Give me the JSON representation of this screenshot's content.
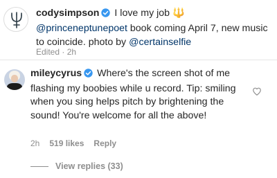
{
  "post": {
    "username": "codysimpson",
    "caption_start": "I love my job",
    "caption_emoji": "🔱",
    "mention1": "@princeneptunepoet",
    "caption_mid": " book coming April 7, new music to coincide. photo by ",
    "mention2": "@certainselfie",
    "edited": "Edited",
    "time": "2h",
    "avatar_icon": "trident-icon"
  },
  "comment": {
    "username": "mileycyrus",
    "text": "Where's the screen shot of me flashing my boobies while u record. Tip: smiling when you sing helps pitch by brightening the sound! You're welcome for all the above!",
    "time": "2h",
    "likes": "519 likes",
    "reply_label": "Reply",
    "view_replies": "View replies (33)"
  },
  "colors": {
    "verified": "#3897f0",
    "mention": "#003569",
    "muted": "#8e8e8e",
    "trident": "#d9a400"
  }
}
